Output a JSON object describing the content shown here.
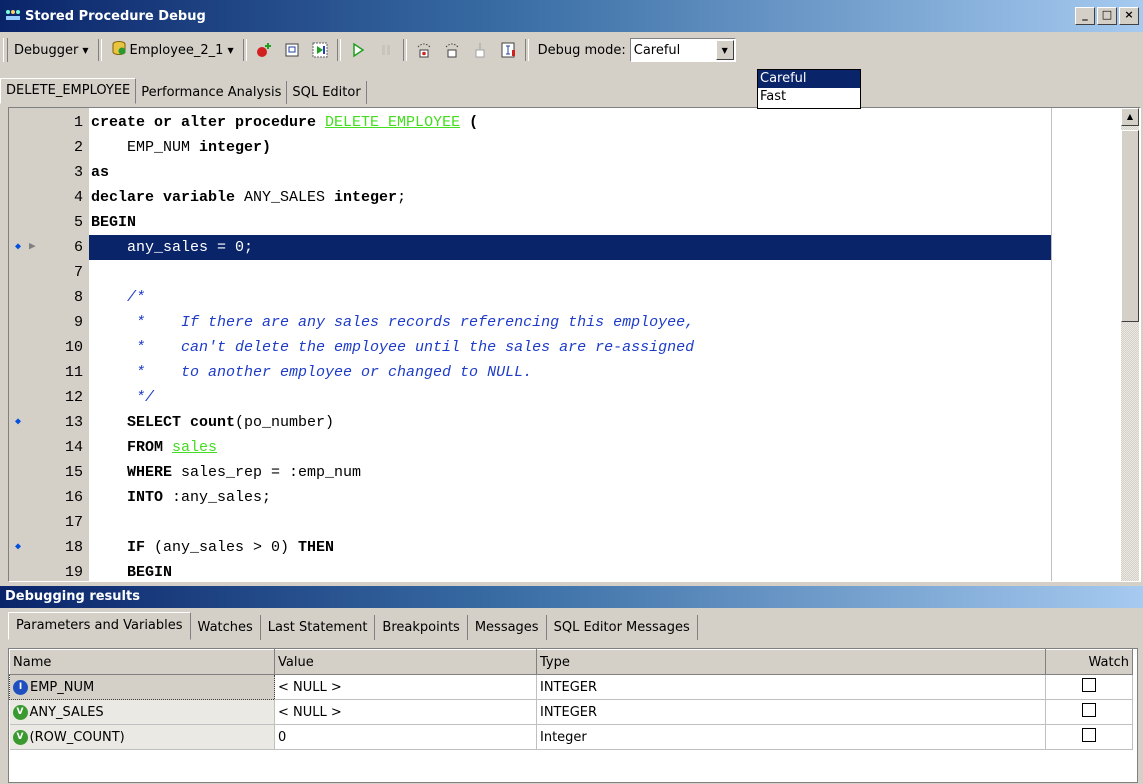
{
  "window": {
    "title": "Stored Procedure Debug",
    "icon": "debug-app-icon",
    "controls": [
      "_",
      "□",
      "×"
    ]
  },
  "toolbar": {
    "debugger_label": "Debugger",
    "database_label": "Employee_2_1",
    "debug_mode_label": "Debug mode:",
    "debug_mode_value": "Careful",
    "icons": [
      "toggle-breakpoint-icon",
      "evaluate-icon",
      "run-to-cursor-icon",
      "run-icon",
      "pause-icon",
      "step-into-icon",
      "step-over-icon",
      "step-out-icon",
      "reset-icon"
    ]
  },
  "debug_mode_dropdown": {
    "options": [
      "Careful",
      "Fast"
    ],
    "selected": "Careful"
  },
  "editor_tabs": [
    "DELETE_EMPLOYEE",
    "Performance Analysis",
    "SQL Editor"
  ],
  "editor": {
    "current_line": 6,
    "breakpoints": [
      6,
      13,
      18
    ],
    "line_numbers": [
      "1",
      "2",
      "3",
      "4",
      "5",
      "6",
      "7",
      "8",
      "9",
      "10",
      "11",
      "12",
      "13",
      "14",
      "15",
      "16",
      "17",
      "18",
      "19"
    ],
    "lines": [
      [
        [
          "kw",
          "create or alter procedure "
        ],
        [
          "obj",
          "DELETE_EMPLOYEE"
        ],
        [
          "kw",
          " ("
        ]
      ],
      [
        [
          "pl",
          "    "
        ],
        [
          "pl",
          "EMP_NUM "
        ],
        [
          "kw",
          "integer)"
        ]
      ],
      [
        [
          "kw",
          "as"
        ]
      ],
      [
        [
          "kw",
          "declare variable "
        ],
        [
          "pl",
          "ANY_SALES "
        ],
        [
          "kw",
          "integer"
        ],
        [
          "pl",
          ";"
        ]
      ],
      [
        [
          "kw",
          "BEGIN"
        ]
      ],
      [
        [
          "pl",
          "    any_sales = 0;"
        ]
      ],
      [
        [
          "pl",
          ""
        ]
      ],
      [
        [
          "cmt",
          "    /*"
        ]
      ],
      [
        [
          "cmt",
          "     *    If there are any sales records referencing this employee,"
        ]
      ],
      [
        [
          "cmt",
          "     *    can't delete the employee until the sales are re-assigned"
        ]
      ],
      [
        [
          "cmt",
          "     *    to another employee or changed to NULL."
        ]
      ],
      [
        [
          "cmt",
          "     */"
        ]
      ],
      [
        [
          "kw",
          "    SELECT count"
        ],
        [
          "pl",
          "(po_number)"
        ]
      ],
      [
        [
          "kw",
          "    FROM "
        ],
        [
          "obj",
          "sales"
        ]
      ],
      [
        [
          "kw",
          "    WHERE "
        ],
        [
          "pl",
          "sales_rep = :emp_num"
        ]
      ],
      [
        [
          "kw",
          "    INTO "
        ],
        [
          "pl",
          ":any_sales;"
        ]
      ],
      [
        [
          "pl",
          ""
        ]
      ],
      [
        [
          "kw",
          "    IF "
        ],
        [
          "pl",
          "(any_sales > 0) "
        ],
        [
          "kw",
          "THEN"
        ]
      ],
      [
        [
          "kw",
          "    BEGIN"
        ]
      ]
    ]
  },
  "results": {
    "title": "Debugging results",
    "tabs": [
      "Parameters and Variables",
      "Watches",
      "Last Statement",
      "Breakpoints",
      "Messages",
      "SQL Editor Messages"
    ],
    "columns": [
      "Name",
      "Value",
      "Type",
      "Watch"
    ],
    "rows": [
      {
        "kind": "input-parameter-icon",
        "badge": "I",
        "name": "EMP_NUM",
        "value": "< NULL >",
        "type": "INTEGER",
        "watch": false
      },
      {
        "kind": "variable-icon",
        "badge": "V",
        "name": "ANY_SALES",
        "value": "< NULL >",
        "type": "INTEGER",
        "watch": false
      },
      {
        "kind": "variable-icon",
        "badge": "V",
        "name": "(ROW_COUNT)",
        "value": "0",
        "type": "Integer",
        "watch": false
      }
    ]
  },
  "colors": {
    "highlight": "#0a246a",
    "comment": "#1e3cc8",
    "object_link": "#44dd22",
    "breakpoint": "#0050e0"
  }
}
